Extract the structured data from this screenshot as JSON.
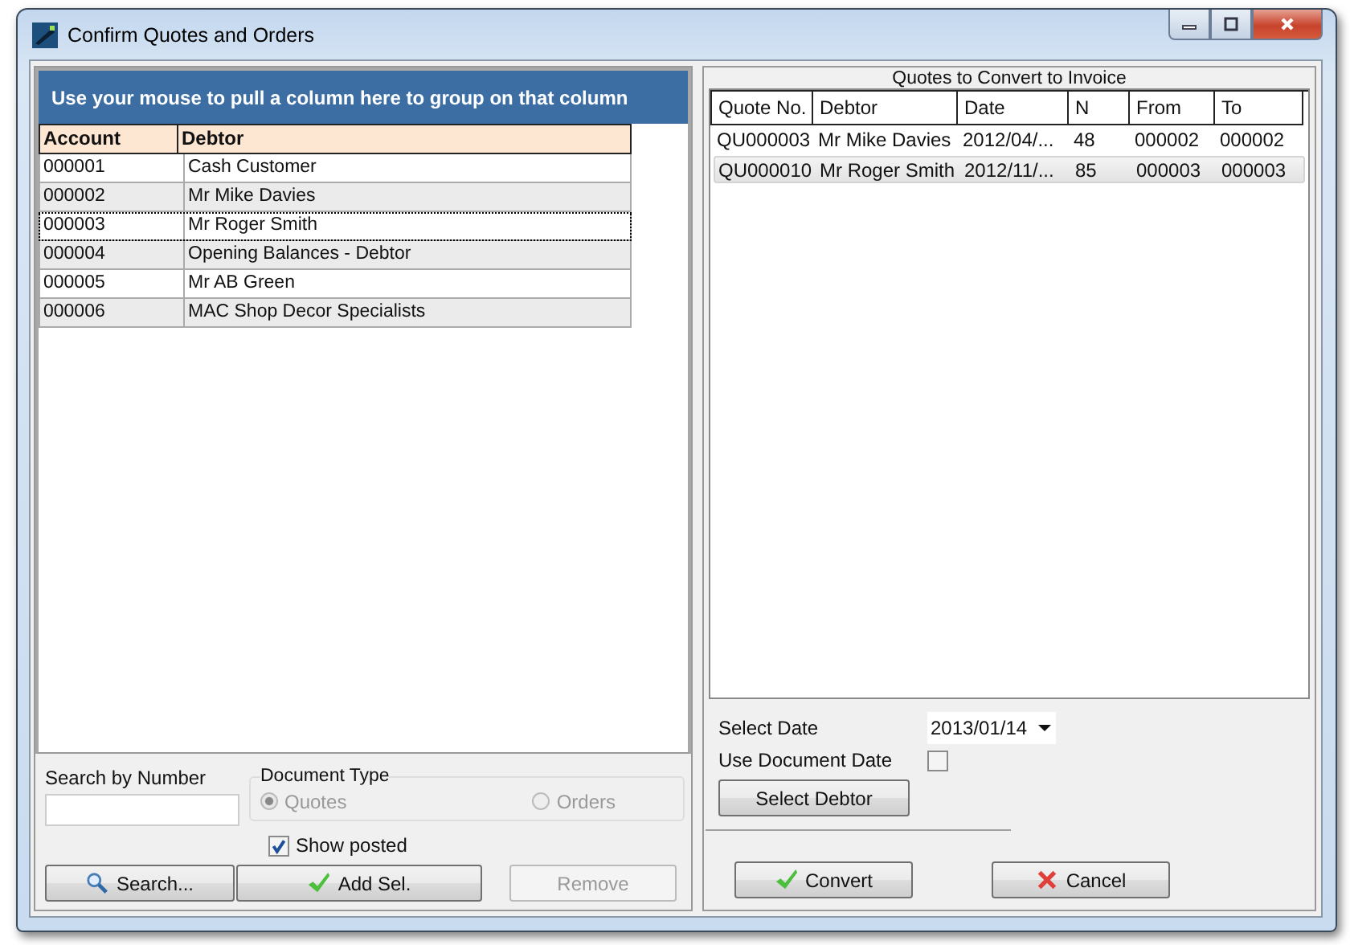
{
  "window": {
    "title": "Confirm Quotes and Orders"
  },
  "group_hint": "Use your mouse to pull a column here to group on that column",
  "debtors": {
    "columns": [
      "Account",
      "Debtor"
    ],
    "rows": [
      {
        "cells": [
          "000001",
          "Cash Customer"
        ],
        "focused": false
      },
      {
        "cells": [
          "000002",
          "Mr Mike Davies"
        ],
        "focused": false
      },
      {
        "cells": [
          "000003",
          "Mr Roger Smith"
        ],
        "focused": true
      },
      {
        "cells": [
          "000004",
          "Opening Balances - Debtor"
        ],
        "focused": false
      },
      {
        "cells": [
          "000005",
          "Mr AB Green"
        ],
        "focused": false
      },
      {
        "cells": [
          "000006",
          "MAC Shop Decor Specialists"
        ],
        "focused": false
      }
    ]
  },
  "search": {
    "label": "Search by Number"
  },
  "document_type": {
    "label": "Document Type",
    "options": [
      {
        "label": "Quotes",
        "selected": true,
        "disabled": true
      },
      {
        "label": "Orders",
        "selected": false,
        "disabled": true
      }
    ]
  },
  "show_posted": {
    "label": "Show posted",
    "checked": true
  },
  "left_buttons": [
    {
      "label": "Search...",
      "disabled": false
    },
    {
      "label": "Add Sel.",
      "disabled": false
    },
    {
      "label": "Remove",
      "disabled": true
    }
  ],
  "quotes": {
    "title": "Quotes to Convert to Invoice",
    "columns": [
      "Quote No.",
      "Debtor",
      "Date",
      "N",
      "From",
      "To"
    ],
    "rows": [
      {
        "cells": [
          "QU000003",
          "Mr Mike Davies",
          "2012/04/...",
          "48",
          "000002",
          "000002"
        ],
        "selected": false
      },
      {
        "cells": [
          "QU000010",
          "Mr Roger Smith",
          "2012/11/...",
          "85",
          "000003",
          "000003"
        ],
        "selected": true
      }
    ]
  },
  "select_date": {
    "label": "Select Date",
    "value": "2013/01/14"
  },
  "use_document_date": {
    "label": "Use Document Date",
    "checked": false
  },
  "select_debtor": "Select Debtor",
  "bottom_buttons": [
    {
      "label": "Convert"
    },
    {
      "label": "Cancel"
    }
  ]
}
